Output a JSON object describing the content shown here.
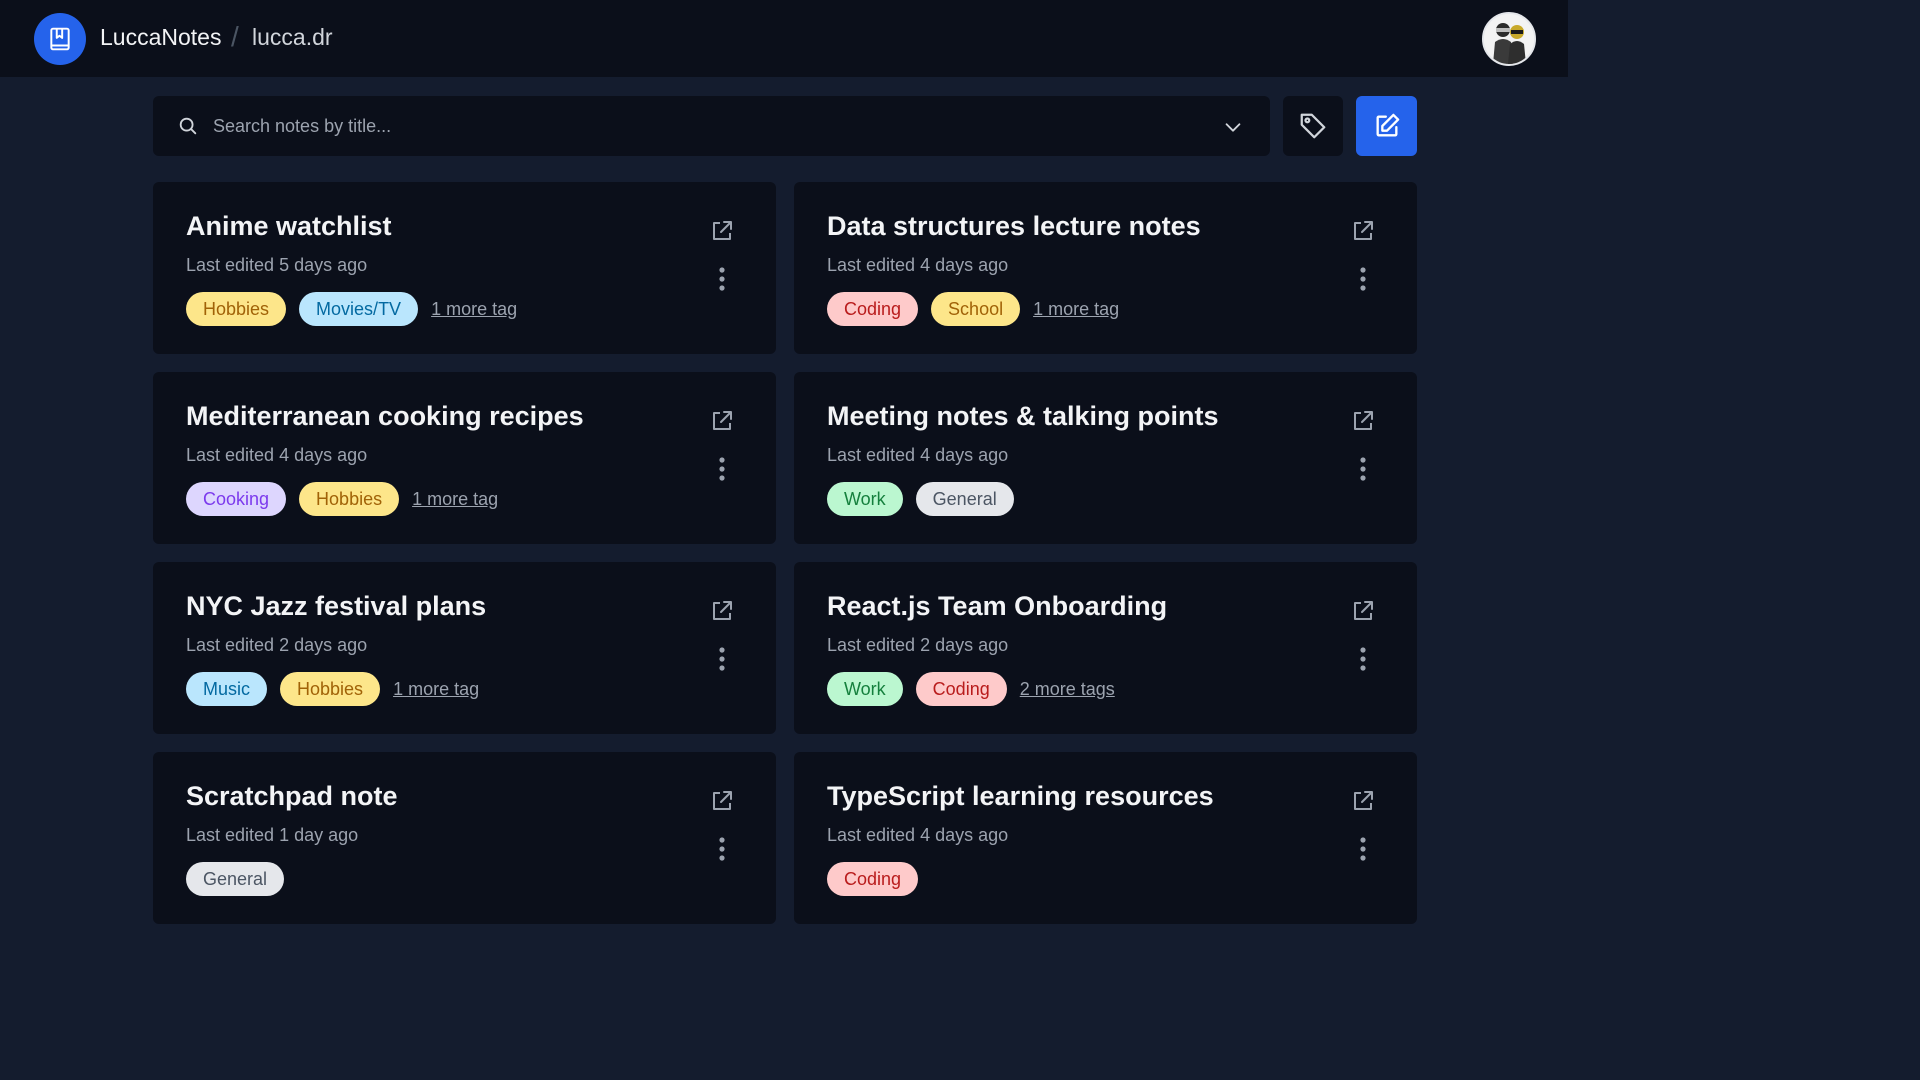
{
  "header": {
    "brand": "LuccaNotes",
    "separator": "/",
    "username": "lucca.dr"
  },
  "search": {
    "placeholder": "Search notes by title...",
    "value": ""
  },
  "notes": [
    {
      "title": "Anime watchlist",
      "edited": "Last edited 5 days ago",
      "tags": [
        {
          "label": "Hobbies",
          "color": "yellow"
        },
        {
          "label": "Movies/TV",
          "color": "blue"
        }
      ],
      "more": "1 more tag"
    },
    {
      "title": "Data structures lecture notes",
      "edited": "Last edited 4 days ago",
      "tags": [
        {
          "label": "Coding",
          "color": "red"
        },
        {
          "label": "School",
          "color": "yellow"
        }
      ],
      "more": "1 more tag"
    },
    {
      "title": "Mediterranean cooking recipes",
      "edited": "Last edited 4 days ago",
      "tags": [
        {
          "label": "Cooking",
          "color": "purple"
        },
        {
          "label": "Hobbies",
          "color": "yellow"
        }
      ],
      "more": "1 more tag"
    },
    {
      "title": "Meeting notes & talking points",
      "edited": "Last edited 4 days ago",
      "tags": [
        {
          "label": "Work",
          "color": "green"
        },
        {
          "label": "General",
          "color": "gray"
        }
      ],
      "more": ""
    },
    {
      "title": "NYC Jazz festival plans",
      "edited": "Last edited 2 days ago",
      "tags": [
        {
          "label": "Music",
          "color": "blue"
        },
        {
          "label": "Hobbies",
          "color": "yellow"
        }
      ],
      "more": "1 more tag"
    },
    {
      "title": "React.js Team Onboarding",
      "edited": "Last edited 2 days ago",
      "tags": [
        {
          "label": "Work",
          "color": "green"
        },
        {
          "label": "Coding",
          "color": "red"
        }
      ],
      "more": "2 more tags"
    },
    {
      "title": "Scratchpad note",
      "edited": "Last edited 1 day ago",
      "tags": [
        {
          "label": "General",
          "color": "gray"
        }
      ],
      "more": ""
    },
    {
      "title": "TypeScript learning resources",
      "edited": "Last edited 4 days ago",
      "tags": [
        {
          "label": "Coding",
          "color": "red"
        }
      ],
      "more": ""
    }
  ],
  "colors": {
    "accent": "#2563eb",
    "background": "#141c2e",
    "surface": "#0b0f1a"
  }
}
